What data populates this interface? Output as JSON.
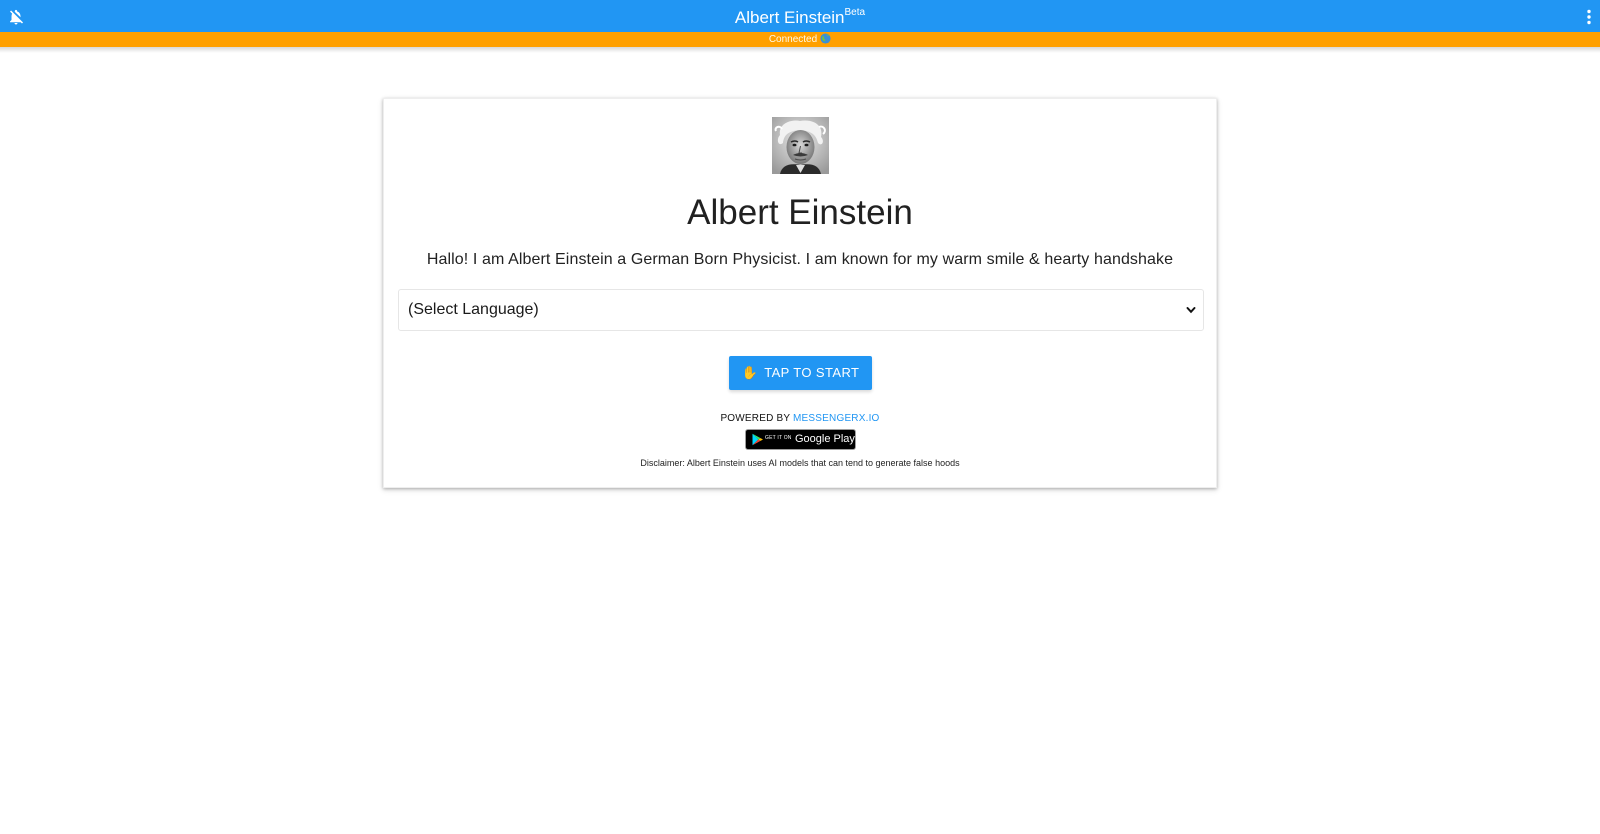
{
  "header": {
    "title": "Albert Einstein",
    "title_sup": "Beta",
    "bell_icon": "bell-off-icon",
    "menu_icon": "more-vertical-icon",
    "background": "#2196f3"
  },
  "status": {
    "text": "Connected",
    "icon": "globe-icon",
    "background": "#ffa000"
  },
  "card": {
    "avatar_icon": "bot-avatar",
    "name": "Albert Einstein",
    "description": "Hallo! I am Albert Einstein a German Born Physicist. I am known for my warm smile & hearty handshake",
    "language_select": {
      "value": "(Select Language)",
      "icon": "chevron-down-icon"
    },
    "start_button": {
      "icon": "✋",
      "label": "TAP TO START",
      "color": "#2196f3"
    },
    "powered_by": {
      "prefix": "POWERED BY ",
      "link": "MESSENGERX.IO"
    },
    "google_play": {
      "small": "GET IT ON",
      "large": "Google Play"
    },
    "disclaimer": "Disclaimer: Albert Einstein uses AI models that can tend to generate false hoods"
  }
}
